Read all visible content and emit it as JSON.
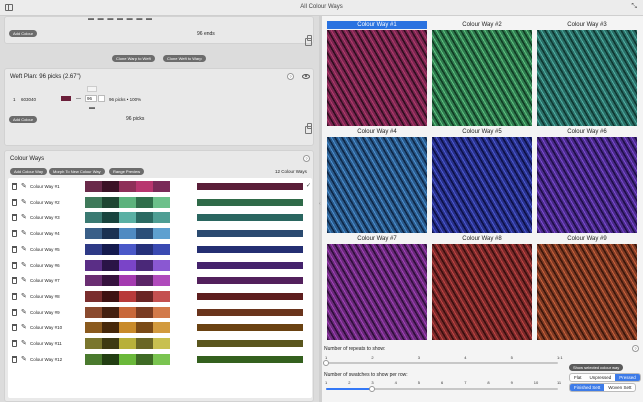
{
  "window": {
    "title": "All Colour Ways"
  },
  "warp": {
    "add_colour_label": "Add Colour",
    "ends_label": "96 ends",
    "clone_warp_label": "Clone Warp to Weft",
    "clone_weft_label": "Clone Weft to Warp"
  },
  "weft": {
    "title": "Weft Plan:  96 picks (2.67\")",
    "help": "?",
    "row_index": "1",
    "row_code": "603040",
    "row_count": "96",
    "row_picks": "96 picks • 100%",
    "add_colour_label": "Add Colour",
    "picks_label": "96 picks",
    "row_color": "#6b1f3a"
  },
  "colourways": {
    "title": "Colour Ways",
    "help": "?",
    "add_label": "Add Colour Way",
    "morph_label": "Morph To New Colour Way",
    "range_label": "Range Preview",
    "count_label": "12 Colour Ways",
    "items": [
      {
        "name": "Colour Way #1",
        "colors": [
          "#6a2a4a",
          "#3b1226",
          "#8e2f58",
          "#b8366f",
          "#7a2a58"
        ],
        "mix": "#5a1e38",
        "selected": true
      },
      {
        "name": "Colour Way #2",
        "colors": [
          "#3f7a5a",
          "#1e4632",
          "#5cb27c",
          "#2f6e4a",
          "#6cc08a"
        ],
        "mix": "#2f6a48",
        "selected": false
      },
      {
        "name": "Colour Way #3",
        "colors": [
          "#3a7a72",
          "#18443e",
          "#5ab0a4",
          "#2a6a62",
          "#4e9e94"
        ],
        "mix": "#2a6660",
        "selected": false
      },
      {
        "name": "Colour Way #4",
        "colors": [
          "#3a5f88",
          "#1a3152",
          "#4f8ac2",
          "#2a4e78",
          "#5ea0d0"
        ],
        "mix": "#2a4a70",
        "selected": false
      },
      {
        "name": "Colour Way #5",
        "colors": [
          "#2e3a86",
          "#141a4e",
          "#4a58c8",
          "#25307a",
          "#3a4ab2"
        ],
        "mix": "#242e72",
        "selected": false
      },
      {
        "name": "Colour Way #6",
        "colors": [
          "#5a2e86",
          "#2a1446",
          "#7a44c8",
          "#4a2878",
          "#8a58d2"
        ],
        "mix": "#44226c",
        "selected": false
      },
      {
        "name": "Colour Way #7",
        "colors": [
          "#6a2e72",
          "#36123e",
          "#a43ab0",
          "#5a2466",
          "#b04abc"
        ],
        "mix": "#52205c",
        "selected": false
      },
      {
        "name": "Colour Way #8",
        "colors": [
          "#7a2e2e",
          "#3e1212",
          "#b83a3a",
          "#6a2424",
          "#c45050"
        ],
        "mix": "#5e1e1e",
        "selected": false
      },
      {
        "name": "Colour Way #9",
        "colors": [
          "#8a4a2e",
          "#442010",
          "#c8683a",
          "#7a3c22",
          "#d27a4a"
        ],
        "mix": "#6a341c",
        "selected": false
      },
      {
        "name": "Colour Way #10",
        "colors": [
          "#8a5a1e",
          "#46280a",
          "#c88a2a",
          "#7a4a16",
          "#d29a3e"
        ],
        "mix": "#6a4212",
        "selected": false
      },
      {
        "name": "Colour Way #11",
        "colors": [
          "#7a762e",
          "#3e3a12",
          "#b8b03a",
          "#6a6624",
          "#c8c050"
        ],
        "mix": "#5a561e",
        "selected": false
      },
      {
        "name": "Colour Way #12",
        "colors": [
          "#4a7a2e",
          "#223e12",
          "#6ab83a",
          "#3e6a24",
          "#7ac450"
        ],
        "mix": "#34601e",
        "selected": false
      }
    ]
  },
  "preview": {
    "thumbs": [
      {
        "label": "Colour Way #1",
        "c1": "#7a2550",
        "c2": "#2e0e1e",
        "c3": "#b03a6a",
        "selected": true
      },
      {
        "label": "Colour Way #2",
        "c1": "#2f7a4e",
        "c2": "#103a22",
        "c3": "#5cc07e",
        "selected": false
      },
      {
        "label": "Colour Way #3",
        "c1": "#2a6e66",
        "c2": "#0e3630",
        "c3": "#4eaea2",
        "selected": false
      },
      {
        "label": "Colour Way #4",
        "c1": "#2a5a8a",
        "c2": "#0e2646",
        "c3": "#4a8ed0",
        "selected": false
      },
      {
        "label": "Colour Way #5",
        "c1": "#28308a",
        "c2": "#0c1046",
        "c3": "#4a58d0",
        "selected": false
      },
      {
        "label": "Colour Way #6",
        "c1": "#4a2a8a",
        "c2": "#1e0e46",
        "c3": "#7a4ad0",
        "selected": false
      },
      {
        "label": "Colour Way #7",
        "c1": "#6a2a7a",
        "c2": "#2e0e3a",
        "c3": "#a040b8",
        "selected": false
      },
      {
        "label": "Colour Way #8",
        "c1": "#7a2a2a",
        "c2": "#3a0e0e",
        "c3": "#c04242",
        "selected": false
      },
      {
        "label": "Colour Way #9",
        "c1": "#7e3a24",
        "c2": "#3a160a",
        "c3": "#c8603a",
        "selected": false
      }
    ],
    "repeats_label": "Number of repeats to show:",
    "repeats_ticks": [
      "1",
      "2",
      "3",
      "4",
      "5",
      "1:1"
    ],
    "repeats_value": 0,
    "swatches_label": "Number of swatches to show per row:",
    "swatches_ticks": [
      "1",
      "2",
      "3",
      "4",
      "5",
      "6",
      "7",
      "8",
      "9",
      "10",
      "11"
    ],
    "swatches_value": 3,
    "help": "?",
    "show_selected_label": "Show selected colour way",
    "finish_options": [
      "Flat",
      "Unpressed",
      "Pressed"
    ],
    "finish_selected": "Pressed",
    "sett_options": [
      "Finished Sett",
      "Woven Sett"
    ],
    "sett_selected": "Finished Sett"
  }
}
